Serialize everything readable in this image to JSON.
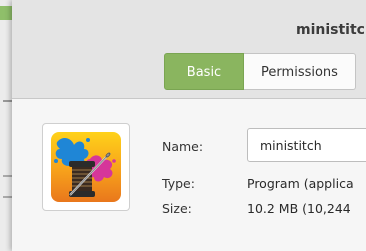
{
  "window": {
    "title": "ministitch"
  },
  "tabs": [
    {
      "label": "Basic",
      "active": true
    },
    {
      "label": "Permissions",
      "active": false
    }
  ],
  "properties": {
    "name_label": "Name:",
    "name_value": "ministitch",
    "type_label": "Type:",
    "type_value": "Program (applica",
    "size_label": "Size:",
    "size_value": "10.2 MB (10,244"
  },
  "icon": {
    "name": "ministitch-app-icon"
  },
  "colors": {
    "accent_tab": "#8ab55f",
    "header_bg": "#e4e4e4",
    "content_bg": "#f6f6f6"
  }
}
